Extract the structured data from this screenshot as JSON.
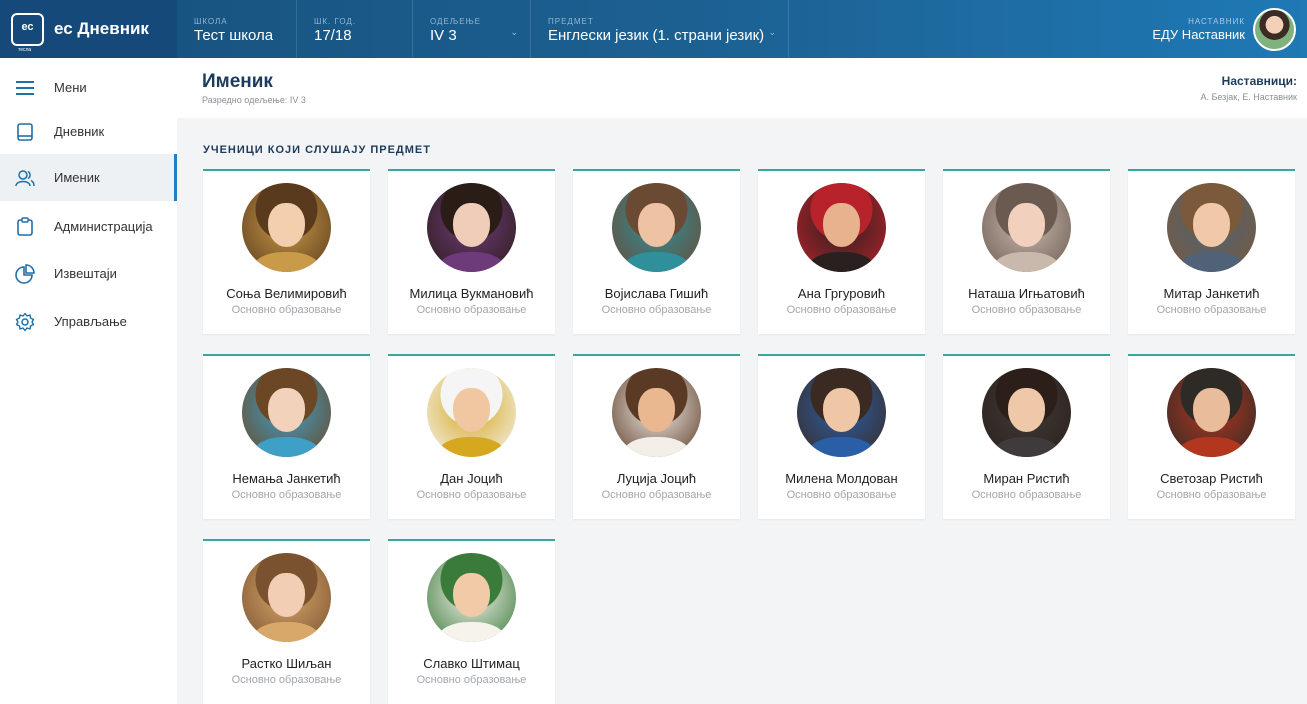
{
  "app": {
    "logo_text": "ес",
    "logo_sub": "тесла",
    "title": "ес Дневник"
  },
  "topbar": {
    "school": {
      "label": "ШКОЛА",
      "value": "Тест школа"
    },
    "year": {
      "label": "ШК. ГОД.",
      "value": "17/18"
    },
    "class": {
      "label": "ОДЕЉЕЊЕ",
      "value": "IV 3"
    },
    "subject": {
      "label": "ПРЕДМЕТ",
      "value": "Енглески језик (1. страни језик)"
    },
    "teacher": {
      "label": "НАСТАВНИК",
      "value": "ЕДУ Наставник"
    }
  },
  "sidebar": {
    "items": [
      {
        "label": "Мени",
        "icon": "menu-icon"
      },
      {
        "label": "Дневник",
        "icon": "book-icon"
      },
      {
        "label": "Именик",
        "icon": "users-icon",
        "active": true
      },
      {
        "label": "Администрација",
        "icon": "clipboard-icon"
      },
      {
        "label": "Извештаји",
        "icon": "pie-chart-icon"
      },
      {
        "label": "Управљање",
        "icon": "gear-icon"
      }
    ]
  },
  "page": {
    "title": "Именик",
    "subtitle": "Разредно одељење: IV 3",
    "teachers_title": "Наставници:",
    "teachers_names": "А. Безјак, Е. Наставник",
    "section_title": "УЧЕНИЦИ КОЈИ СЛУШАЈУ ПРЕДМЕТ"
  },
  "students": [
    {
      "name": "Соња Велимировић",
      "edu": "Основно образовање"
    },
    {
      "name": "Милица Вукмановић",
      "edu": "Основно образовање"
    },
    {
      "name": "Војислава Гишић",
      "edu": "Основно образовање"
    },
    {
      "name": "Ана Гргуровић",
      "edu": "Основно образовање"
    },
    {
      "name": "Наташа Игњатовић",
      "edu": "Основно образовање"
    },
    {
      "name": "Митар Јанкетић",
      "edu": "Основно образовање"
    },
    {
      "name": "Немања Јанкетић",
      "edu": "Основно образовање"
    },
    {
      "name": "Дан Јоцић",
      "edu": "Основно образовање"
    },
    {
      "name": "Луција Јоцић",
      "edu": "Основно образовање"
    },
    {
      "name": "Милена Молдован",
      "edu": "Основно образовање"
    },
    {
      "name": "Миран Ристић",
      "edu": "Основно образовање"
    },
    {
      "name": "Светозар Ристић",
      "edu": "Основно образовање"
    },
    {
      "name": "Растко Шиљан",
      "edu": "Основно образовање"
    },
    {
      "name": "Славко Штимац",
      "edu": "Основно образовање"
    }
  ],
  "colors": {
    "topbar": "#1c6193",
    "accent": "#1f7fc4",
    "card_border": "#3aa6a0",
    "title": "#1d3b5b"
  }
}
